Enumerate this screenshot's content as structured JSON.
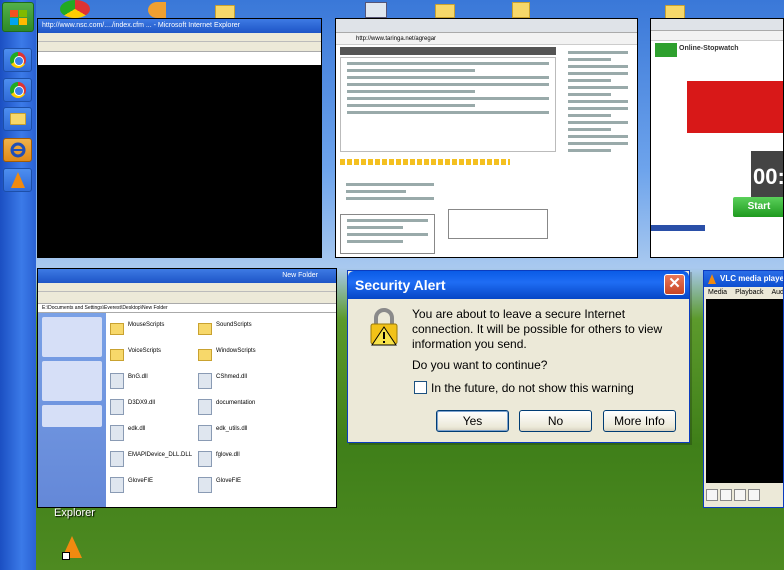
{
  "taskbar": {
    "items": [
      {
        "icon": "chrome-icon"
      },
      {
        "icon": "chrome-icon"
      },
      {
        "icon": "folder-icon"
      },
      {
        "icon": "internet-explorer-icon",
        "active": true
      },
      {
        "icon": "vlc-icon"
      }
    ]
  },
  "browser_thumb": {
    "title": "http://www.nsc.com/..../index.cfm ... - Microsoft Internet Explorer"
  },
  "blog_thumb": {
    "url": "http://www.taringa.net/agregar"
  },
  "stopwatch_thumb": {
    "title": "Online-Stopwatch",
    "time": "00:",
    "start_label": "Start"
  },
  "explorer_thumb": {
    "title": "New Folder",
    "address": "E:\\Documents and Settings\\Everest\\Desktop\\New Folder",
    "items": [
      {
        "name": "MouseScripts",
        "folder": true
      },
      {
        "name": "SoundScripts",
        "folder": true
      },
      {
        "name": "VoiceScripts",
        "folder": true
      },
      {
        "name": "WindowScripts",
        "folder": true
      },
      {
        "name": "BnG.dll",
        "folder": false
      },
      {
        "name": "CShmed.dll",
        "folder": false
      },
      {
        "name": "D3DX9.dll",
        "folder": false
      },
      {
        "name": "documentation",
        "folder": false
      },
      {
        "name": "edk.dll",
        "folder": false
      },
      {
        "name": "edk_utils.dll",
        "folder": false
      },
      {
        "name": "EMAPIDevice_DLL.DLL",
        "folder": false
      },
      {
        "name": "fglove.dll",
        "folder": false
      },
      {
        "name": "GloveFIE",
        "folder": false
      },
      {
        "name": "GloveFIE",
        "folder": false
      }
    ]
  },
  "explorer_caption": "Explorer",
  "dialog": {
    "title": "Security Alert",
    "message": "You are about to leave a secure Internet connection.  It will be possible for others to view information you send.",
    "question": "Do you want to continue?",
    "checkbox_label": "In the future, do not show this warning",
    "checkbox_checked": false,
    "buttons": {
      "yes": "Yes",
      "no": "No",
      "more_info": "More Info"
    },
    "close_glyph": "✕"
  },
  "vlc": {
    "title": "VLC media player",
    "menu": [
      "Media",
      "Playback",
      "Audio"
    ]
  }
}
